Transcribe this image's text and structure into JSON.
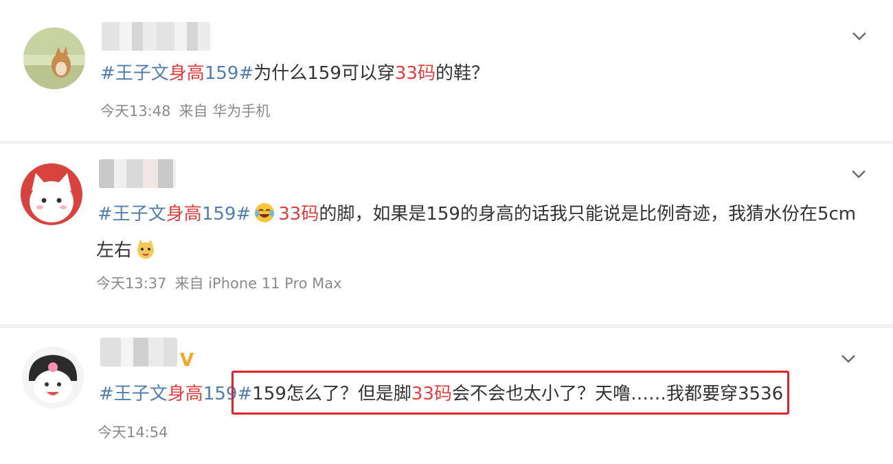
{
  "posts": [
    {
      "topic_prefix": "#王子文",
      "topic_middle": "身高",
      "topic_suffix": "159#",
      "text_a": "为什么159可以穿",
      "highlight": "33码",
      "text_b": "的鞋？",
      "time": "今天13:48",
      "source": "来自 华为手机"
    },
    {
      "topic_prefix": "#王子文",
      "topic_middle": "身高",
      "topic_suffix": "159#",
      "emoji_a": "laughing-crying-emoji",
      "highlight": "33码",
      "text_a": "的脚，如果是159的身高的话我只能说是比例奇迹，我猜水份在5cm",
      "text_b": "左右",
      "emoji_b": "cat-emoji",
      "time": "今天13:37",
      "source": "来自 iPhone 11 Pro Max"
    },
    {
      "topic_prefix": "#王子文",
      "topic_middle": "身高",
      "topic_suffix": "159#",
      "text_a": "159怎么了？但是脚",
      "highlight": "33码",
      "text_b": "会不会也太小了？天噜……我都要穿3536",
      "verified_badge": "V",
      "time": "今天14:54"
    }
  ],
  "colors": {
    "topic": "#507daf",
    "highlight": "#e23d3d",
    "meta": "#8a8a8a",
    "box": "#e0232b",
    "verified": "#f5a623"
  }
}
